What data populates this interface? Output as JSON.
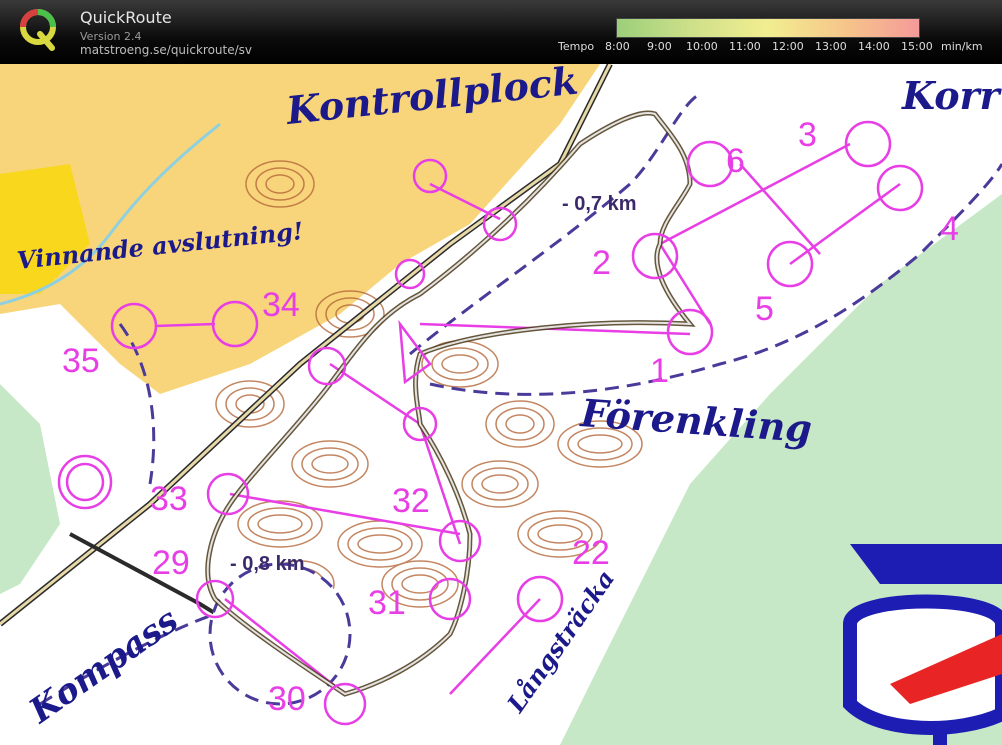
{
  "app": {
    "title": "QuickRoute",
    "version": "Version 2.4",
    "url": "matstroeng.se/quickroute/sv"
  },
  "tempo_legend": {
    "label": "Tempo",
    "ticks": [
      "8:00",
      "9:00",
      "10:00",
      "11:00",
      "12:00",
      "13:00",
      "14:00",
      "15:00"
    ],
    "unit": "min/km",
    "gradient_colors": [
      "#9ccf7a",
      "#cfe08a",
      "#f2ee90",
      "#f6c68a",
      "#f59a9a"
    ]
  },
  "map": {
    "area_labels": {
      "kontrollplock": "Kontrollplock",
      "vinnande": "Vinnande avslutning!",
      "forenkling": "Förenkling",
      "kompass": "Kompass",
      "langstracka": "Långsträcka",
      "korr": "Korr"
    },
    "distances": {
      "top": "- 0,7 km",
      "bottom": "- 0,8 km"
    },
    "controls": {
      "c1": "1",
      "c2": "2",
      "c3": "3",
      "c4": "4",
      "c5": "5",
      "c6": "6",
      "c22": "22",
      "c29": "29",
      "c30": "30",
      "c31": "31",
      "c32": "32",
      "c33": "33",
      "c34": "34",
      "c35": "35"
    },
    "colors": {
      "course": "#e83ee6",
      "route_dark": "#4a3a1a",
      "route_light": "#f3f3f3",
      "text": "#1c1a8a",
      "open_land": "#f8d57a",
      "forest_white": "#ffffff",
      "green": "#c6e8c6",
      "contour": "#b5683a"
    }
  }
}
